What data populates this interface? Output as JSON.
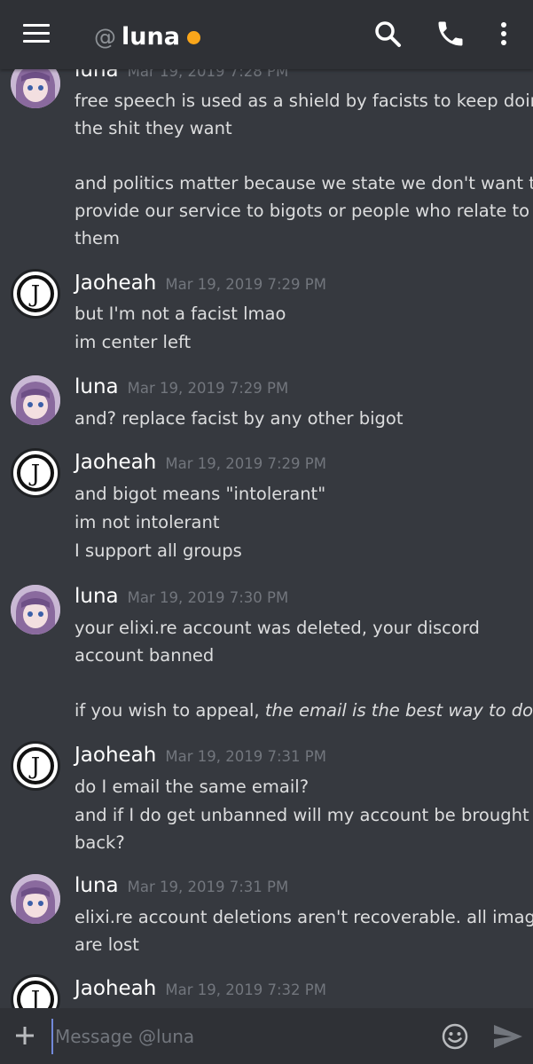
{
  "header": {
    "at_symbol": "@",
    "channel_name": "luna",
    "status_color": "#faa61a",
    "icons": [
      "hamburger-menu-icon",
      "search-icon",
      "phone-icon",
      "more-vertical-icon"
    ]
  },
  "messages": [
    {
      "author": "luna",
      "time": "Mar 19, 2019 7:28 PM",
      "lines": [
        "free speech is used as a shield by facists to keep doing",
        "the shit they want",
        "and politics matter because we state we don't want to",
        "provide our service to bigots or people who relate to",
        "them"
      ]
    },
    {
      "author": "Jaoheah",
      "time": "Mar 19, 2019 7:29 PM",
      "lines": [
        "but I'm not a facist lmao",
        "im center left"
      ]
    },
    {
      "author": "luna",
      "time": "Mar 19, 2019 7:29 PM",
      "lines": [
        "and? replace facist by any other bigot"
      ]
    },
    {
      "author": "Jaoheah",
      "time": "Mar 19, 2019 7:29 PM",
      "lines": [
        "and bigot means \"intolerant\"",
        "im not intolerant",
        "I support all groups"
      ]
    },
    {
      "author": "luna",
      "time": "Mar 19, 2019 7:30 PM",
      "lines": [
        "your elixi.re account was deleted, your discord",
        "account banned",
        "if you wish to appeal, "
      ],
      "italic": "the email is the best way to do it"
    },
    {
      "author": "Jaoheah",
      "time": "Mar 19, 2019 7:31 PM",
      "lines": [
        "do I email the same email?",
        "and if I do get unbanned will my account be brought",
        "back?"
      ]
    },
    {
      "author": "luna",
      "time": "Mar 19, 2019 7:31 PM",
      "lines": [
        "elixi.re account deletions aren't recoverable. all images",
        "are lost"
      ]
    },
    {
      "author": "Jaoheah",
      "time": "Mar 19, 2019 7:32 PM",
      "lines": []
    }
  ],
  "composer": {
    "placeholder": "Message @luna",
    "accent_color": "#7289da"
  }
}
